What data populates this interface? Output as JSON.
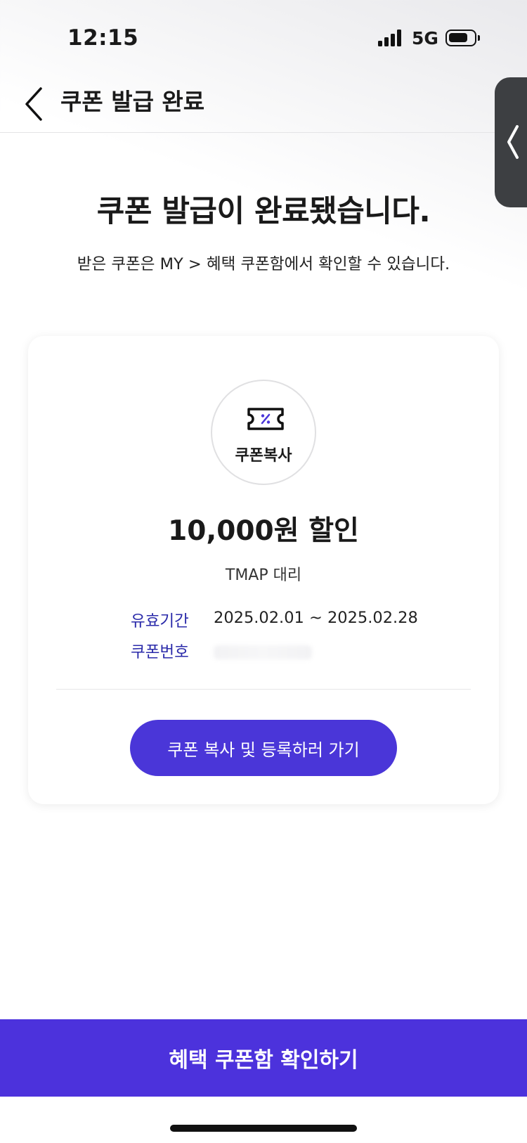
{
  "status_bar": {
    "time": "12:15",
    "network": "5G"
  },
  "header": {
    "back_icon": "chevron-left-icon",
    "title": "쿠폰 발급 완료"
  },
  "side_handle": {
    "icon": "chevron-left-icon"
  },
  "main": {
    "heading": "쿠폰 발급이 완료됐습니다.",
    "subheading": "받은 쿠폰은 MY > 혜택 쿠폰함에서 확인할 수 있습니다."
  },
  "card": {
    "coupon_icon": "ticket-percent-icon",
    "coupon_copy_label": "쿠폰복사",
    "discount": "10,000원 할인",
    "brand": "TMAP 대리",
    "validity_label": "유효기간",
    "validity_value": "2025.02.01 ~ 2025.02.28",
    "code_label": "쿠폰번호",
    "register_button": "쿠폰 복사 및 등록하러 가기"
  },
  "bottom": {
    "button": "혜택 쿠폰함 확인하기"
  },
  "colors": {
    "accent": "#4a36d8",
    "label_blue": "#2b2baa"
  }
}
